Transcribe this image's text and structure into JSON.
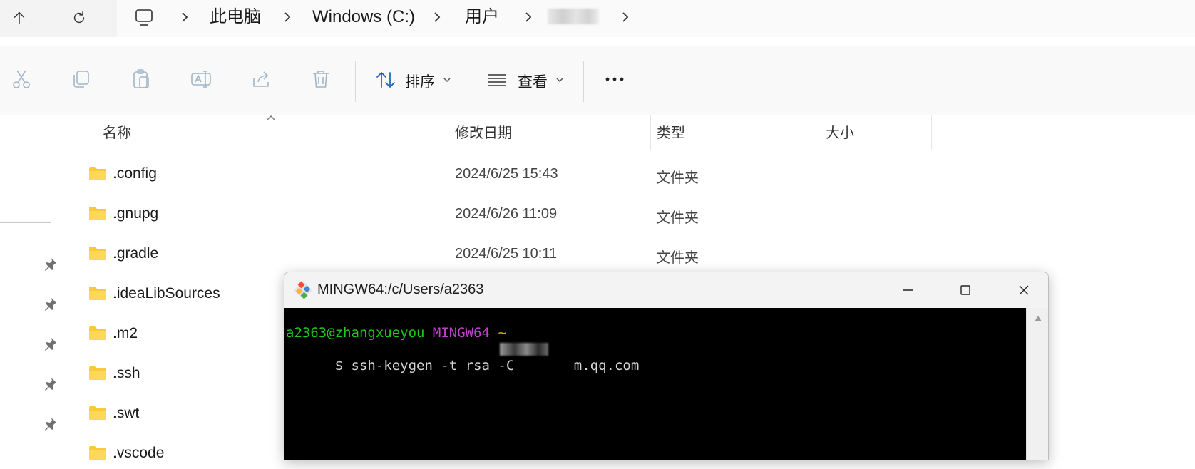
{
  "breadcrumb": {
    "items": [
      "此电脑",
      "Windows (C:)",
      "用户"
    ]
  },
  "toolbar": {
    "sort_label": "排序",
    "view_label": "查看"
  },
  "file_list": {
    "columns": {
      "name": "名称",
      "modified": "修改日期",
      "type": "类型",
      "size": "大小"
    },
    "rows": [
      {
        "name": ".config",
        "modified": "2024/6/25 15:43",
        "type": "文件夹"
      },
      {
        "name": ".gnupg",
        "modified": "2024/6/26 11:09",
        "type": "文件夹"
      },
      {
        "name": ".gradle",
        "modified": "2024/6/25 10:11",
        "type": "文件夹"
      },
      {
        "name": ".ideaLibSources",
        "modified": "",
        "type": ""
      },
      {
        "name": ".m2",
        "modified": "",
        "type": ""
      },
      {
        "name": ".ssh",
        "modified": "",
        "type": ""
      },
      {
        "name": ".swt",
        "modified": "",
        "type": ""
      },
      {
        "name": ".vscode",
        "modified": "",
        "type": ""
      }
    ]
  },
  "terminal": {
    "title": "MINGW64:/c/Users/a2363",
    "prompt_user": "a2363@zhangxueyou",
    "prompt_env": "MINGW64",
    "prompt_path": "~",
    "command_prefix": "$ ssh-keygen -t rsa -C ",
    "command_suffix": "m.qq.com"
  },
  "colors": {
    "folder": "#f8c93c",
    "terminal_bg": "#000000",
    "prompt_green": "#1ec81e",
    "prompt_purple": "#c23fd0",
    "prompt_yellow": "#c8b400"
  },
  "icons": {
    "nav": [
      "up-arrow-icon",
      "refresh-icon"
    ],
    "toolbar": [
      "cut-icon",
      "copy-icon",
      "paste-icon",
      "rename-icon",
      "share-icon",
      "delete-icon",
      "sort-icon",
      "view-icon",
      "more-icon"
    ],
    "window": [
      "minimize-icon",
      "maximize-icon",
      "close-icon"
    ]
  }
}
